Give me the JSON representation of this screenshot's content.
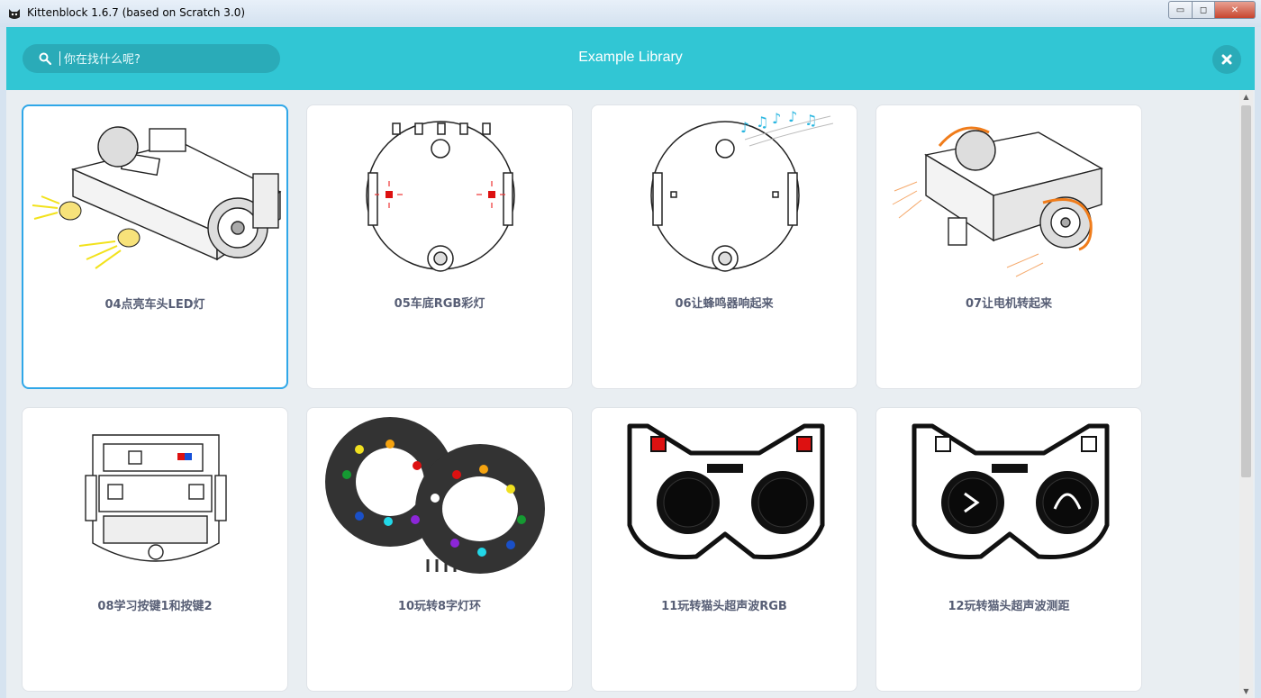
{
  "window": {
    "title": "Kittenblock 1.6.7 (based on Scratch 3.0)",
    "controls": {
      "minimize": "▭",
      "maximize": "◻",
      "close": "✕"
    }
  },
  "library": {
    "title": "Example Library",
    "search": {
      "placeholder": "你在找什么呢?"
    },
    "close_icon": "✖",
    "items": [
      {
        "label": "04点亮车头LED灯",
        "selected": true
      },
      {
        "label": "05车底RGB彩灯"
      },
      {
        "label": "06让蜂鸣器响起来"
      },
      {
        "label": "07让电机转起来"
      },
      {
        "label": "08学习按键1和按键2"
      },
      {
        "label": "10玩转8字灯环"
      },
      {
        "label": "11玩转猫头超声波RGB"
      },
      {
        "label": "12玩转猫头超声波测距"
      }
    ]
  },
  "colors": {
    "header": "#31c6d4",
    "selected_border": "#2fa7e8",
    "label": "#575e75"
  }
}
